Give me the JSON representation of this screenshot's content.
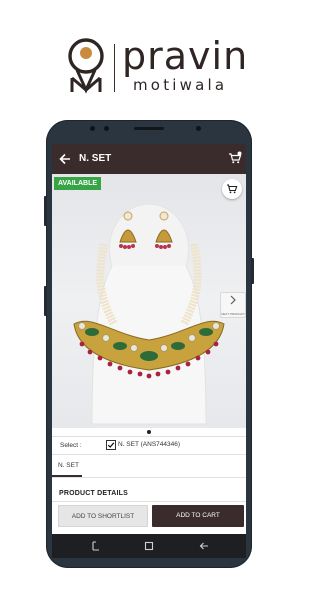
{
  "brand": {
    "name": "pravin",
    "subtitle": "motiwala"
  },
  "appbar": {
    "title": "N. SET",
    "back_icon": "arrow-left-icon",
    "cart_icon": "cart-icon"
  },
  "product": {
    "badge": "AVAILABLE",
    "next_label": "NEXT PRODUCT",
    "image_icon": "necklace-set-image"
  },
  "select": {
    "label": "Select :",
    "option": "N. SET (ANS744346)",
    "checked": true
  },
  "tab": {
    "label": "N. SET"
  },
  "details": {
    "title": "PRODUCT DETAILS"
  },
  "buttons": {
    "shortlist": "ADD TO SHORTLIST",
    "cart": "ADD TO CART"
  },
  "colors": {
    "primary": "#3a2b2c",
    "badge": "#37a545",
    "frame": "#2b3540"
  }
}
